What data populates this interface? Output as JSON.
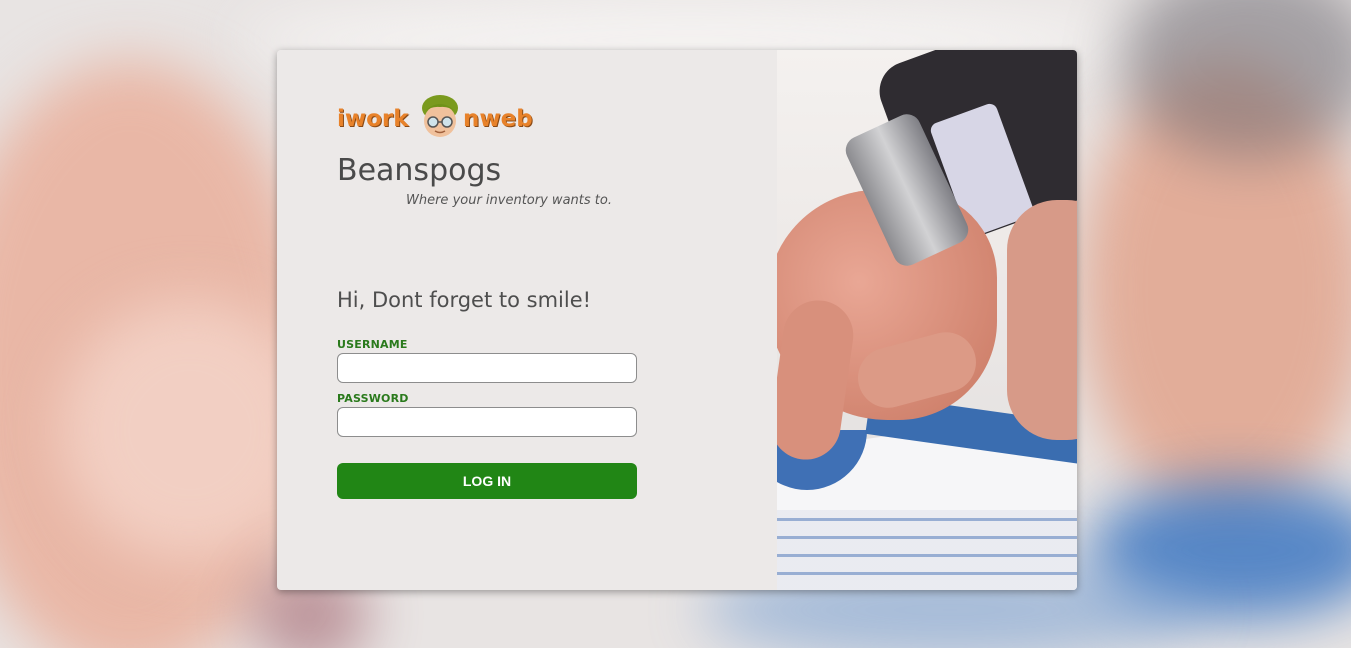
{
  "brand": {
    "logo_left": "iwork",
    "logo_right": "nweb",
    "app_name": "Beanspogs",
    "tagline": "Where your inventory wants to."
  },
  "login": {
    "greeting": "Hi, Dont forget to smile!",
    "username_label": "USERNAME",
    "username_value": "",
    "password_label": "PASSWORD",
    "password_value": "",
    "submit_label": "LOG IN"
  },
  "colors": {
    "accent": "#218615",
    "label": "#2a7a1c",
    "logo": "#e8822a",
    "panel": "#ece9e8"
  },
  "icons": {
    "logo_face": "cartoon-face-with-glasses"
  }
}
